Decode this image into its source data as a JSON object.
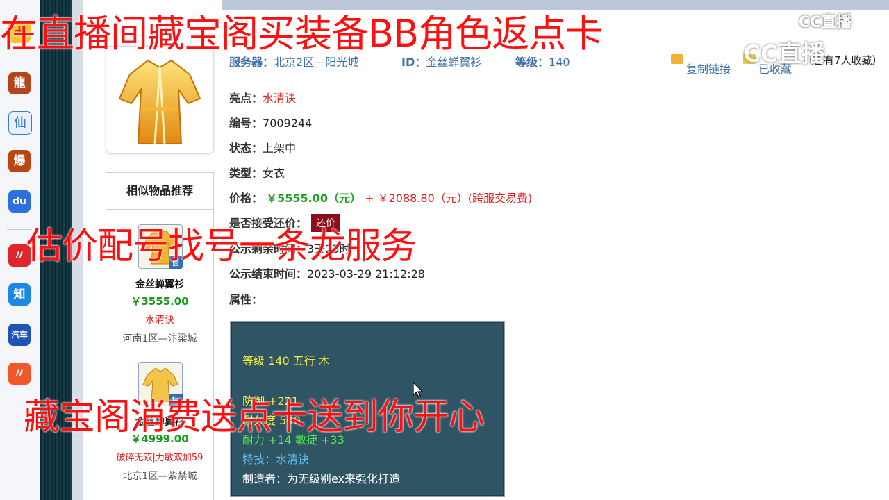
{
  "overlay": {
    "line1": "在直播间藏宝阁买装备BB角色返点卡",
    "line2": "估价配号找号一条龙服务",
    "line3": "藏宝阁消费送点卡送到你开心"
  },
  "watermark": {
    "logo": "CC直播",
    "logo_large": "CC直播"
  },
  "dock": {
    "apps": [
      {
        "icon": "game-dragon-icon",
        "glyph": "龍",
        "color": "#b5441b"
      },
      {
        "icon": "xian-game-icon",
        "glyph": "仙",
        "color": "#3a7cc8"
      },
      {
        "icon": "game-explode-icon",
        "glyph": "爆",
        "color": "#b8470f"
      },
      {
        "icon": "baidu-icon",
        "glyph": "du",
        "color": "#2e6fe0"
      },
      {
        "icon": "red-swoosh-icon",
        "glyph": "〃",
        "color": "#e0262b"
      },
      {
        "icon": "zhihu-icon",
        "glyph": "知",
        "color": "#1e86e6"
      },
      {
        "icon": "car-app-icon",
        "glyph": "汽车",
        "color": "#2053b8"
      },
      {
        "icon": "orange-swoosh-icon",
        "glyph": "〃",
        "color": "#f0582a"
      }
    ]
  },
  "header": {
    "server_label": "服务器：",
    "server": "北京2区—阳光城",
    "id_label": "ID：",
    "id_value": "金丝蝉翼衫",
    "level_label": "等级：",
    "level": "140",
    "copy_link": "复制链接",
    "favorite": "已收藏",
    "favorite_count": "（已有7人收藏）"
  },
  "details": {
    "highlight_label": "亮点：",
    "highlight": "水清诀",
    "serial_label": "编号：",
    "serial": "7009244",
    "status_label": "状态：",
    "status": "上架中",
    "type_label": "类型：",
    "type": "女衣",
    "price_label": "价格：",
    "price": "￥5555.00（元）",
    "price_plus": "+",
    "fee": "￥2088.80（元）(跨服交易费)",
    "bargain_label": "是否接受还价：",
    "bargain_button": "还价",
    "remaining_label": "公示剩余时间：",
    "remaining": "3天23时",
    "end_label": "公示结束时间：",
    "end": "2023-03-29 21:12:28",
    "attr_label": "属性："
  },
  "attributes": {
    "level_line": "等级 140 五行 木",
    "defense_line": "防御 +221",
    "durability_line": "耐久度 500",
    "stats_line": "耐力 +14 敏捷 +33",
    "skill_line": "特技：水清诀",
    "maker_line": "制造者：为无级别ex来强化打造"
  },
  "recommend": {
    "title": "相似物品推荐",
    "sale_badge": "售",
    "items": [
      {
        "name": "金丝蝉翼衫",
        "price": "￥3555.00",
        "tag": "水清诀",
        "server": "河南1区—汴梁城"
      },
      {
        "name": "金丝蝉翼衫",
        "price": "￥4999.00",
        "tag": "破碎无双|力敏双加59",
        "server": "北京1区—紫禁城"
      }
    ]
  },
  "colors": {
    "accent_red": "#e01e1e",
    "price_green": "#22a022",
    "panel_bg": "#2f5565",
    "link_blue": "#3b6ea8"
  }
}
